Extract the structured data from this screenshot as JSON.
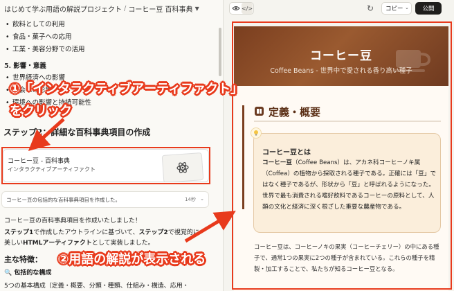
{
  "left": {
    "breadcrumb": {
      "project": "はじめて学ぶ用語の解説プロジェクト",
      "separator": "/",
      "page": "コーヒー豆 百科事典"
    },
    "list1": [
      "飲料としての利用",
      "食品・菓子への応用",
      "工業・美容分野での活用"
    ],
    "section5": "5. 影響・意義",
    "list2": [
      "世界経済への影響",
      "社会への影響",
      "環境への影響と持続可能性"
    ],
    "step2": "ステップ2：詳細な百科事典項目の作成",
    "artifact": {
      "title": "コーヒー豆 - 百科事典",
      "subtitle": "インタラクティブアーティファクト"
    },
    "artifact_row": {
      "text": "コーヒー豆の包括的な百科事典項目を作成した。",
      "time": "14秒"
    },
    "complete": "コーヒー豆の百科事典項目を作成いたしました！",
    "body": {
      "p1": "ステップ1",
      "p2": "で作成したアウトラインに基づいて、",
      "p3": "ステップ2",
      "p4": "で視覚的に",
      "p5": "美しい",
      "p6": "HTMLアーティファクト",
      "p7": "として実装しました。"
    },
    "features": "主な特徴：",
    "comprehensive": "🔍 包括的な構成",
    "five": "5つの基本構成（定義・概要、分類・種類、仕組み・構造、応用・"
  },
  "right": {
    "toolbar": {
      "copy": "コピー",
      "publish": "公開"
    },
    "hero": {
      "title": "コーヒー豆",
      "subtitle": "Coffee Beans - 世界中で愛される香り高い種子"
    },
    "definition": {
      "heading": "定義・概要",
      "box_title": "コーヒー豆とは",
      "box_bold": "コーヒー豆",
      "box_text": "（Coffee Beans）は、アカネ科コーヒーノキ属（Coffea）の植物から採取される種子である。正確には「豆」ではなく種子であるが、形状から「豆」と呼ばれるようになった。世界で最も消費される嗜好飲料であるコーヒーの原料として、人類の文化と経済に深く根ざした重要な農産物である。",
      "para": "コーヒー豆は、コーヒーノキの果実（コーヒーチェリー）の中にある種子で、通常1つの果実に2つの種子が含まれている。これらの種子を精製・加工することで、私たちが知るコーヒー豆となる。"
    }
  },
  "annotations": {
    "step1_line1": "①「インタラクティブアーティファクト」",
    "step1_line2": "をクリック",
    "step2": "②用語の解説が表示される"
  },
  "colors": {
    "accent_red": "#e83a1c",
    "coffee_brown": "#7a3e1f",
    "box_cream": "#fbeedb"
  }
}
